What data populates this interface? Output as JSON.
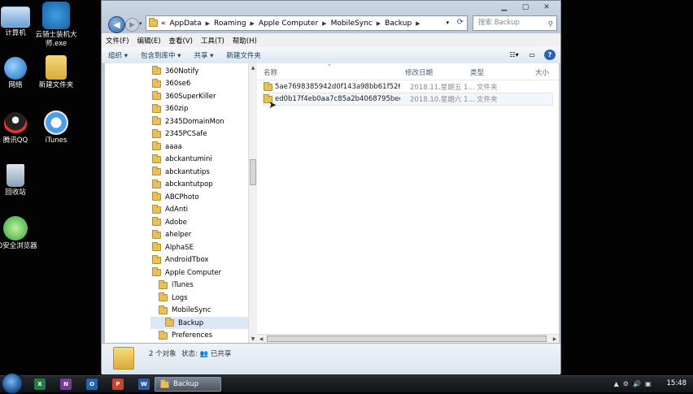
{
  "desktop_icons": [
    {
      "label": "计算机",
      "icon": "computer-icon"
    },
    {
      "label": "云骑士装机大师.exe",
      "icon": "knight-app-icon"
    },
    {
      "label": "网络",
      "icon": "network-icon"
    },
    {
      "label": "新建文件夹",
      "icon": "folder-icon"
    },
    {
      "label": "腾讯QQ",
      "icon": "qq-penguin-icon"
    },
    {
      "label": "iTunes",
      "icon": "itunes-icon"
    },
    {
      "label": "回收站",
      "icon": "recycle-bin-icon"
    },
    {
      "label": "60安全浏览器",
      "icon": "browser-e-icon"
    }
  ],
  "address_bar": {
    "crumbs": [
      "AppData",
      "Roaming",
      "Apple Computer",
      "MobileSync",
      "Backup"
    ],
    "prefix": "«"
  },
  "search": {
    "placeholder": "搜索 Backup"
  },
  "menu": [
    "文件(F)",
    "编辑(E)",
    "查看(V)",
    "工具(T)",
    "帮助(H)"
  ],
  "toolbar": {
    "organize": "组织 ▾",
    "include": "包含到库中 ▾",
    "share": "共享 ▾",
    "new_folder": "新建文件夹"
  },
  "tree": [
    {
      "label": "360Notify",
      "level": 0
    },
    {
      "label": "360se6",
      "level": 0
    },
    {
      "label": "360SuperKiller",
      "level": 0
    },
    {
      "label": "360zip",
      "level": 0
    },
    {
      "label": "2345DomainMon",
      "level": 0
    },
    {
      "label": "2345PCSafe",
      "level": 0
    },
    {
      "label": "aaaa",
      "level": 0
    },
    {
      "label": "abckantumini",
      "level": 0
    },
    {
      "label": "abckantutips",
      "level": 0
    },
    {
      "label": "abckantutpop",
      "level": 0
    },
    {
      "label": "ABCPhoto",
      "level": 0
    },
    {
      "label": "AdAnti",
      "level": 0
    },
    {
      "label": "Adobe",
      "level": 0
    },
    {
      "label": "ahelper",
      "level": 0
    },
    {
      "label": "AlphaSE",
      "level": 0
    },
    {
      "label": "AndroidTbox",
      "level": 0
    },
    {
      "label": "Apple Computer",
      "level": 0
    },
    {
      "label": "iTunes",
      "level": 1
    },
    {
      "label": "Logs",
      "level": 1
    },
    {
      "label": "MobileSync",
      "level": 1
    },
    {
      "label": "Backup",
      "level": 2,
      "selected": true
    },
    {
      "label": "Preferences",
      "level": 1
    }
  ],
  "columns": {
    "name": "名称",
    "date": "修改日期",
    "type": "类型",
    "size": "大小"
  },
  "files": [
    {
      "name": "5ae7698385942d0f143a98bb61f5265...",
      "date": "2018.11.星期五 1...",
      "type": "文件夹"
    },
    {
      "name": "ed0b17f4eb0aa7c85a2b4068795beef...",
      "date": "2018.10.星期六 1...",
      "type": "文件夹"
    }
  ],
  "status": {
    "count": "2 个对象",
    "state_label": "状态:",
    "state_value": "已共享"
  },
  "taskbar": {
    "active_label": "Backup",
    "pinned": [
      {
        "icon": "excel-icon",
        "letter": "X",
        "color": "#1f7a45"
      },
      {
        "icon": "onenote-icon",
        "letter": "N",
        "color": "#7b3a96"
      },
      {
        "icon": "outlook-icon",
        "letter": "O",
        "color": "#1a66b5"
      },
      {
        "icon": "powerpoint-icon",
        "letter": "P",
        "color": "#c8452b"
      },
      {
        "icon": "word-icon",
        "letter": "W",
        "color": "#2a5ba8"
      }
    ],
    "clock": "15:48"
  }
}
